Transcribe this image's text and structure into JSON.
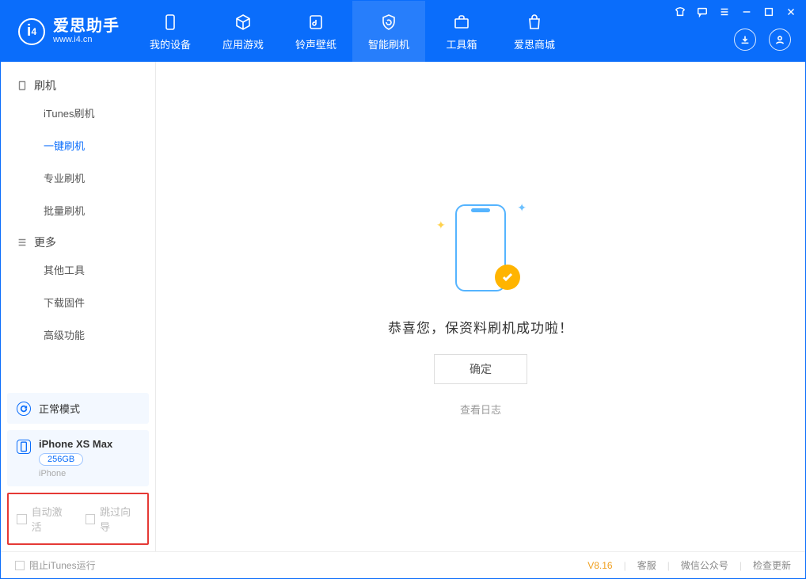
{
  "app": {
    "title": "爱思助手",
    "subtitle": "www.i4.cn"
  },
  "nav": {
    "tabs": [
      {
        "label": "我的设备"
      },
      {
        "label": "应用游戏"
      },
      {
        "label": "铃声壁纸"
      },
      {
        "label": "智能刷机"
      },
      {
        "label": "工具箱"
      },
      {
        "label": "爱思商城"
      }
    ]
  },
  "sidebar": {
    "groups": [
      {
        "title": "刷机",
        "items": [
          {
            "label": "iTunes刷机"
          },
          {
            "label": "一键刷机",
            "active": true
          },
          {
            "label": "专业刷机"
          },
          {
            "label": "批量刷机"
          }
        ]
      },
      {
        "title": "更多",
        "items": [
          {
            "label": "其他工具"
          },
          {
            "label": "下载固件"
          },
          {
            "label": "高级功能"
          }
        ]
      }
    ],
    "mode": {
      "label": "正常模式"
    },
    "device": {
      "name": "iPhone XS Max",
      "capacity": "256GB",
      "type": "iPhone"
    },
    "options": {
      "auto_activate": "自动激活",
      "skip_wizard": "跳过向导"
    }
  },
  "main": {
    "success_text": "恭喜您，保资料刷机成功啦！",
    "ok_button": "确定",
    "view_log": "查看日志"
  },
  "statusbar": {
    "block_itunes": "阻止iTunes运行",
    "version": "V8.16",
    "support": "客服",
    "wechat": "微信公众号",
    "check_update": "检查更新"
  }
}
